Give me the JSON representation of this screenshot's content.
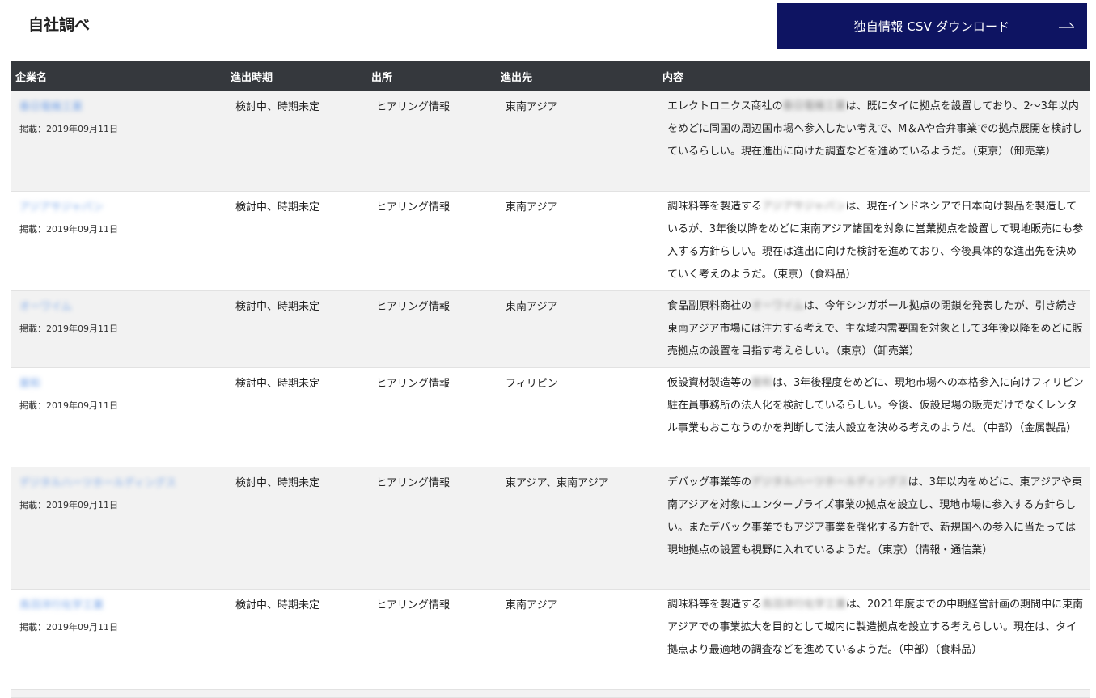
{
  "page": {
    "title": "自社調べ",
    "csv_button_label": "独自情報 CSV ダウンロード"
  },
  "table": {
    "headers": [
      "企業名",
      "進出時期",
      "出所",
      "進出先",
      "内容"
    ],
    "rows": [
      {
        "company": "春日電機工業",
        "posted": "掲載：2019年09月11日",
        "timing": "検討中、時期未定",
        "source": "ヒアリング情報",
        "destination": "東南アジア",
        "content_pre": "エレクトロニクス商社の",
        "content_name": "春日電機工業",
        "content_post": "は、既にタイに拠点を設置しており、2～3年以内をめどに同国の周辺国市場へ参入したい考えで、M＆Aや合弁事業での拠点展開を検討しているらしい。現在進出に向けた調査などを進めているようだ。（東京）（卸売業）"
      },
      {
        "company": "アジアサジャパン",
        "posted": "掲載：2019年09月11日",
        "timing": "検討中、時期未定",
        "source": "ヒアリング情報",
        "destination": "東南アジア",
        "content_pre": "調味料等を製造する",
        "content_name": "アジアサジャパン",
        "content_post": "は、現在インドネシアで日本向け製品を製造しているが、3年後以降をめどに東南アジア諸国を対象に営業拠点を設置して現地販売にも参入する方針らしい。現在は進出に向けた検討を進めており、今後具体的な進出先を決めていく考えのようだ。（東京）（食料品）"
      },
      {
        "company": "オーワイム",
        "posted": "掲載：2019年09月11日",
        "timing": "検討中、時期未定",
        "source": "ヒアリング情報",
        "destination": "東南アジア",
        "content_pre": "食品副原料商社の",
        "content_name": "オーワイム",
        "content_post": "は、今年シンガポール拠点の閉鎖を発表したが、引き続き東南アジア市場には注力する考えで、主な域内需要国を対象として3年後以降をめどに販売拠点の設置を目指す考えらしい。（東京）（卸売業）"
      },
      {
        "company": "屋和",
        "posted": "掲載：2019年09月11日",
        "timing": "検討中、時期未定",
        "source": "ヒアリング情報",
        "destination": "フィリピン",
        "content_pre": "仮設資材製造等の",
        "content_name": "屋和",
        "content_post": "は、3年後程度をめどに、現地市場への本格参入に向けフィリピン駐在員事務所の法人化を検討しているらしい。今後、仮設足場の販売だけでなくレンタル事業もおこなうのかを判断して法人設立を決める考えのようだ。（中部）（金属製品）"
      },
      {
        "company": "デジタルハーツホールディングス",
        "posted": "掲載：2019年09月11日",
        "timing": "検討中、時期未定",
        "source": "ヒアリング情報",
        "destination": "東アジア、東南アジア",
        "content_pre": "デバッグ事業等の",
        "content_name": "デジタルハーツホールディングス",
        "content_post": "は、3年以内をめどに、東アジアや東南アジアを対象にエンタープライズ事業の拠点を設立し、現地市場に参入する方針らしい。またデバック事業でもアジア事業を強化する方針で、新規国への参入に当たっては現地拠点の設置も視野に入れているようだ。（東京）（情報・通信業）"
      },
      {
        "company": "鳥羽洋行化学工業",
        "posted": "掲載：2019年09月11日",
        "timing": "検討中、時期未定",
        "source": "ヒアリング情報",
        "destination": "東南アジア",
        "content_pre": "調味料等を製造する",
        "content_name": "鳥羽洋行化学工業",
        "content_post": "は、2021年度までの中期経営計画の期間中に東南アジアでの事業拡大を目的として域内に製造拠点を設立する考えらしい。現在は、タイ拠点より最適地の調査などを進めているようだ。（中部）（食料品）"
      }
    ]
  }
}
